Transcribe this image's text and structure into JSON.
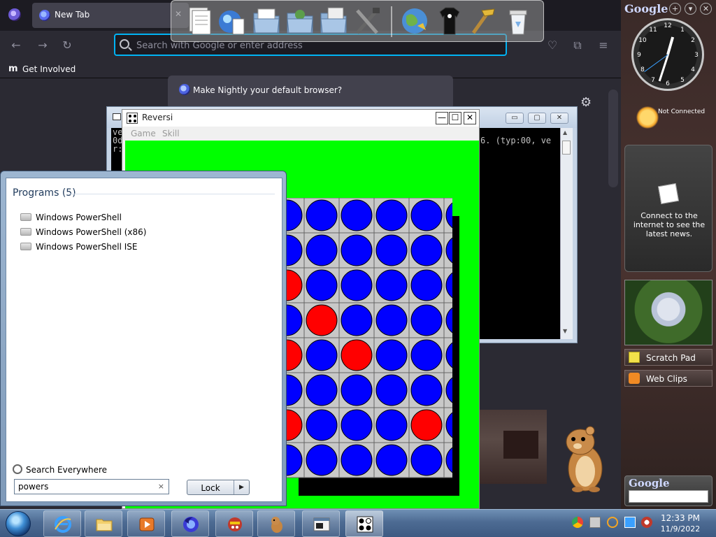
{
  "browser": {
    "tab_title": "New Tab",
    "tab_close": "✕",
    "url_placeholder": "Search with Google or enter address",
    "bookmark_icon": "m",
    "bookmark_label": "Get Involved",
    "default_banner": "Make Nightly your default browser?",
    "nav": {
      "back": "←",
      "forward": "→",
      "reload": "↻",
      "pocket": "♡",
      "extensions": "⧉",
      "menu": "≡"
    },
    "settings_icon": "⚙"
  },
  "dock": {
    "items": [
      "documents-icon",
      "internet-explorer-icon",
      "folder-icon",
      "folder-icon",
      "folder-icon",
      "tools-icon",
      "globe-icon",
      "tshirt-icon",
      "hammer-icon",
      "recycle-bin-icon"
    ]
  },
  "console": {
    "line_right": "6. (typ:00, ve",
    "lines_left": [
      "ve",
      "0d",
      "r:"
    ],
    "btn_min": "▭",
    "btn_max": "▢",
    "btn_close": "✕"
  },
  "reversi": {
    "title": "Reversi",
    "menu": [
      "Game",
      "Skill"
    ],
    "btn_min": "—",
    "btn_max": "☐",
    "btn_close": "✕",
    "colors": {
      "empty": "#0000ff",
      "player": "#ff0000",
      "background": "#00ff00",
      "grid": "#c8c8c8"
    },
    "board": [
      [
        "?",
        "B",
        "B",
        "B",
        "B",
        "B"
      ],
      [
        "?",
        "B",
        "B",
        "B",
        "B",
        "B"
      ],
      [
        "R",
        "B",
        "B",
        "B",
        "B",
        "B"
      ],
      [
        "B",
        "R",
        "B",
        "B",
        "B",
        "B"
      ],
      [
        "R",
        "B",
        "R",
        "B",
        "B",
        "B"
      ],
      [
        "B",
        "B",
        "B",
        "B",
        "B",
        "B"
      ],
      [
        "R",
        "B",
        "B",
        "B",
        "R",
        "B"
      ],
      [
        "B",
        "B",
        "B",
        "B",
        "B",
        "B"
      ]
    ]
  },
  "start_menu": {
    "heading": "Programs (5)",
    "items": [
      "Windows PowerShell",
      "Windows PowerShell (x86)",
      "Windows PowerShell ISE"
    ],
    "search_everywhere": "Search Everywhere",
    "search_value": "powers",
    "search_clear": "×",
    "lock_label": "Lock",
    "lock_arrow": "▶"
  },
  "gsidebar": {
    "logo": "Google",
    "ctrl_add": "+",
    "ctrl_menu": "▾",
    "ctrl_close": "✕",
    "clock_numbers": [
      "12",
      "1",
      "2",
      "3",
      "4",
      "5",
      "6",
      "7",
      "8",
      "9",
      "10",
      "11"
    ],
    "weather_status": "Not Connected",
    "news_text": "Connect to the internet to see the latest news.",
    "scratch_pad": "Scratch Pad",
    "web_clips": "Web Clips",
    "search_logo": "Google"
  },
  "taskbar": {
    "apps": [
      "internet-explorer-icon",
      "file-explorer-icon",
      "media-player-icon",
      "firefox-icon",
      "game-icon",
      "hamster-icon",
      "console-icon",
      "reversi-icon"
    ],
    "time": "12:33 PM",
    "date": "11/9/2022"
  }
}
